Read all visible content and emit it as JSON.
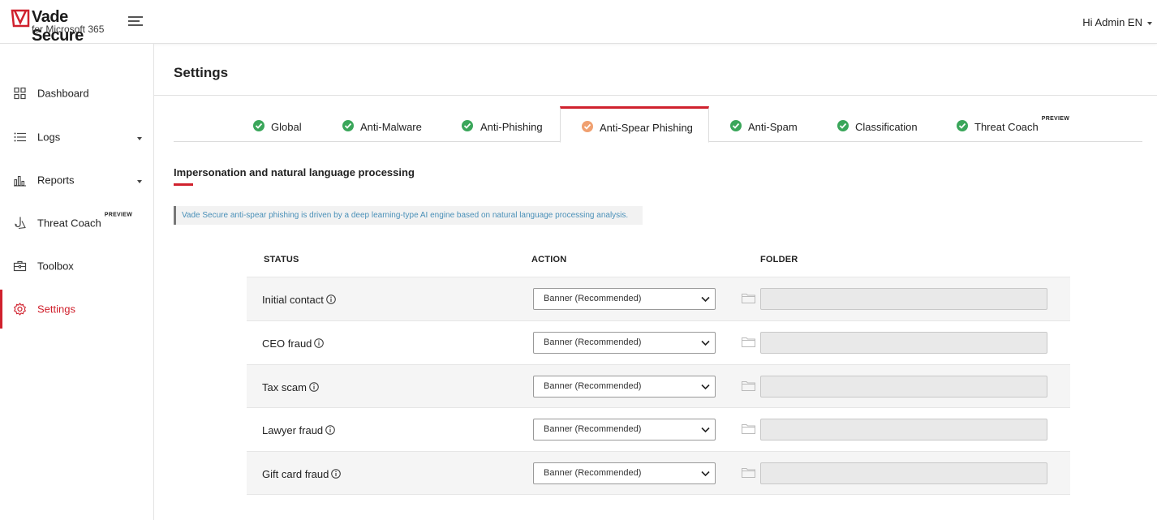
{
  "header": {
    "logo_text": "Vade Secure",
    "logo_sub": "for Microsoft 365",
    "user_greeting": "Hi Admin EN"
  },
  "sidebar": {
    "items": [
      {
        "label": "Dashboard",
        "icon": "dashboard-icon"
      },
      {
        "label": "Logs",
        "icon": "list-icon",
        "has_dropdown": true
      },
      {
        "label": "Reports",
        "icon": "bar-chart-icon",
        "has_dropdown": true
      },
      {
        "label": "Threat Coach",
        "icon": "fishing-hook-icon",
        "badge": "PREVIEW"
      },
      {
        "label": "Toolbox",
        "icon": "toolbox-icon"
      },
      {
        "label": "Settings",
        "icon": "gear-icon",
        "active": true
      }
    ]
  },
  "page": {
    "title": "Settings"
  },
  "tabs": [
    {
      "label": "Global",
      "status": "ok"
    },
    {
      "label": "Anti-Malware",
      "status": "ok"
    },
    {
      "label": "Anti-Phishing",
      "status": "ok"
    },
    {
      "label": "Anti-Spear Phishing",
      "status": "warning",
      "active": true
    },
    {
      "label": "Anti-Spam",
      "status": "ok"
    },
    {
      "label": "Classification",
      "status": "ok"
    },
    {
      "label": "Threat Coach",
      "status": "ok",
      "badge": "PREVIEW"
    }
  ],
  "section": {
    "title": "Impersonation and natural language processing",
    "info": "Vade Secure anti-spear phishing is driven by a deep learning-type AI engine based on natural language processing analysis."
  },
  "table": {
    "headers": {
      "status": "STATUS",
      "action": "ACTION",
      "folder": "FOLDER"
    },
    "rows": [
      {
        "status": "Initial contact",
        "action": "Banner (Recommended)",
        "folder": ""
      },
      {
        "status": "CEO fraud",
        "action": "Banner (Recommended)",
        "folder": ""
      },
      {
        "status": "Tax scam",
        "action": "Banner (Recommended)",
        "folder": ""
      },
      {
        "status": "Lawyer fraud",
        "action": "Banner (Recommended)",
        "folder": ""
      },
      {
        "status": "Gift card fraud",
        "action": "Banner (Recommended)",
        "folder": ""
      }
    ]
  },
  "colors": {
    "brand_red": "#d0212d",
    "check_green": "#3aa65a",
    "warning_orange": "#f0a070",
    "info_blue": "#4a90b8"
  }
}
